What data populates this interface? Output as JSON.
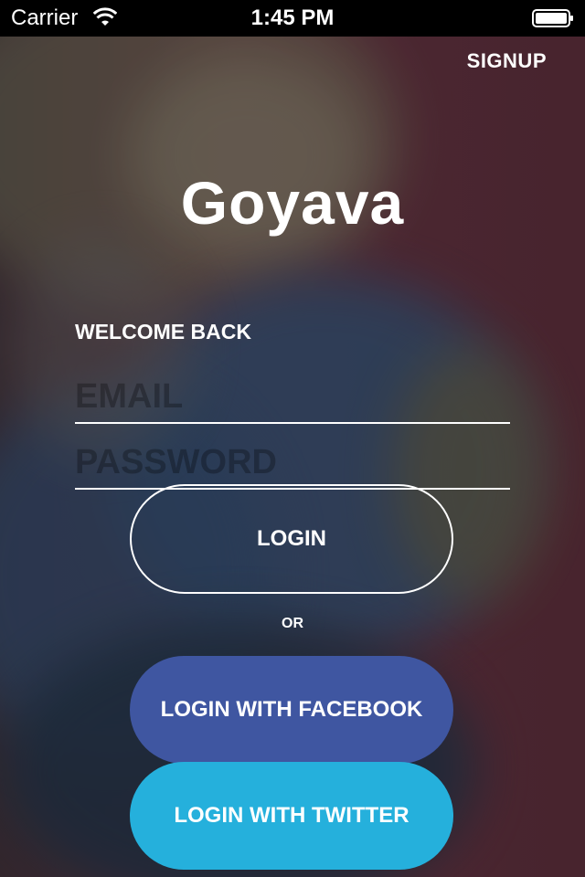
{
  "status_bar": {
    "carrier": "Carrier",
    "time": "1:45 PM",
    "icons": [
      "wifi-icon",
      "battery-icon"
    ]
  },
  "header": {
    "signup_label": "SIGNUP"
  },
  "app": {
    "title": "Goyava"
  },
  "form": {
    "welcome_label": "WELCOME BACK",
    "email_placeholder": "EMAIL",
    "email_value": "",
    "password_placeholder": "PASSWORD",
    "password_value": ""
  },
  "buttons": {
    "login": "LOGIN",
    "or": "OR",
    "facebook": "LOGIN WITH FACEBOOK",
    "twitter": "LOGIN WITH TWITTER"
  },
  "colors": {
    "facebook": "#3f56a1",
    "twitter": "#25b0dc",
    "background": "#4a2530"
  }
}
